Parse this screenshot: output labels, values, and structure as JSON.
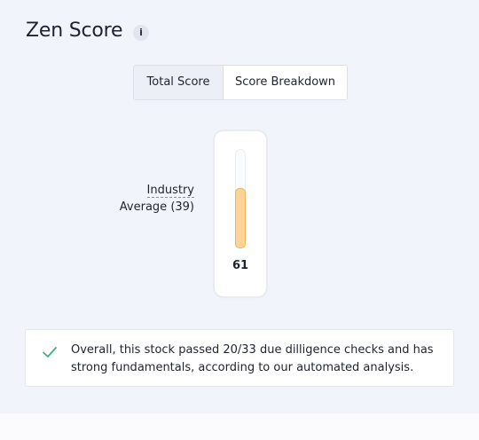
{
  "header": {
    "title": "Zen Score",
    "info_icon": "info-icon"
  },
  "tabs": [
    {
      "label": "Total Score",
      "active": true
    },
    {
      "label": "Score Breakdown",
      "active": false
    }
  ],
  "gauge": {
    "score": "61",
    "score_value": 61,
    "industry_label_line1": "Industry",
    "industry_label_line2": "Average (39)",
    "industry_average": 39,
    "fill_color": "#fdd495"
  },
  "summary": {
    "icon": "check-icon",
    "text": "Overall, this stock passed 20/33 due dilligence checks and has strong fundamentals, according to our automated analysis."
  }
}
